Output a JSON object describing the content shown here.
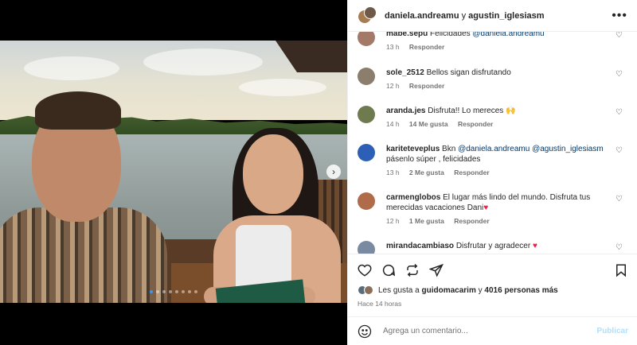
{
  "post": {
    "header": {
      "user1": "daniela.andreamu",
      "connector": "y",
      "user2": "agustin_iglesiasm"
    },
    "carousel": {
      "slide_count": 8,
      "active_index": 0
    }
  },
  "comments": [
    {
      "user": "mabe.sepu",
      "text": "Felicidades ",
      "mention": "@daniela.andreamu",
      "text2": "",
      "time": "13 h",
      "likes": "",
      "reply": "Responder",
      "avatar_color": "#a37a68"
    },
    {
      "user": "sole_2512",
      "text": "Bellos sigan disfrutando",
      "time": "12 h",
      "likes": "",
      "reply": "Responder",
      "avatar_color": "#8c7e6c"
    },
    {
      "user": "aranda.jes",
      "text": "Disfruta!! Lo mereces 🙌",
      "time": "14 h",
      "likes": "14 Me gusta",
      "reply": "Responder",
      "avatar_color": "#6f7a4e"
    },
    {
      "user": "kariteteveplus",
      "text": "Bkn ",
      "mention": "@daniela.andreamu",
      "mention2": "@agustin_iglesiasm",
      "text2": "pásenlo súper , felicidades",
      "time": "13 h",
      "likes": "2 Me gusta",
      "reply": "Responder",
      "avatar_color": "#2c5fb5"
    },
    {
      "user": "carmenglobos",
      "text": "El lugar más lindo del mundo. Disfruta tus merecidas vacaciones Dani",
      "time": "12 h",
      "likes": "1 Me gusta",
      "reply": "Responder",
      "avatar_color": "#b06c4a"
    },
    {
      "user": "mirandacambiaso",
      "text": "Disfrutar y agradecer ",
      "time": "",
      "likes": "",
      "reply": "",
      "avatar_color": "#7a8aa0"
    }
  ],
  "likes_line": {
    "prefix": "Les gusta a",
    "user": "guidomacarim",
    "connector": "y",
    "count": "4016 personas más"
  },
  "timestamp": "Hace 14 horas",
  "composer": {
    "placeholder": "Agrega un comentario...",
    "publish_label": "Publicar"
  },
  "colors": {
    "link_blue": "#00376b",
    "publish_disabled": "#b2dffc",
    "red_heart": "#ed1c48"
  },
  "icons": {
    "header_more": "more-horizontal-icon",
    "actions": [
      "heart-icon",
      "comment-icon",
      "repost-icon",
      "share-icon",
      "bookmark-icon"
    ]
  }
}
